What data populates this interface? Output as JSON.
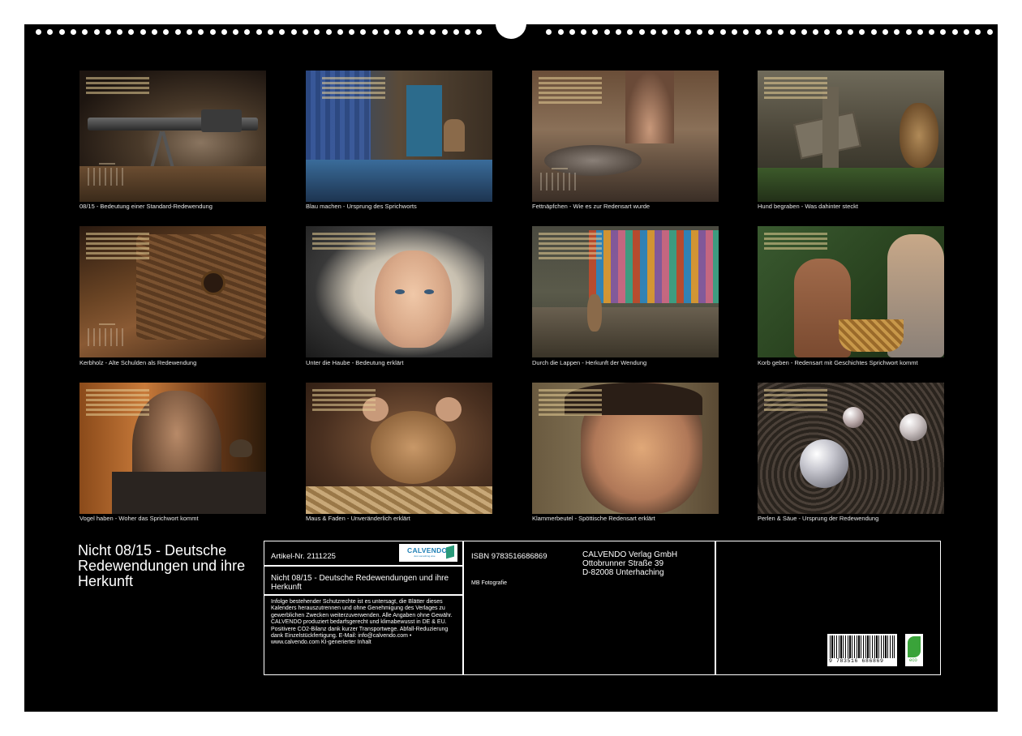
{
  "calendar_title": "Nicht 08/15 - Deutsche Redewendungen und ihre Herkunft",
  "months": [
    {
      "caption": "08/15 - Bedeutung einer Standard-Redewendung",
      "subject": "machine-gun-photo"
    },
    {
      "caption": "Blau machen - Ursprung des Sprichworts",
      "subject": "blue-dye-workshop-photo"
    },
    {
      "caption": "Fettnäpfchen - Wie es zur Redensart wurde",
      "subject": "grease-bowl-photo"
    },
    {
      "caption": "Hund begraben - Was dahinter steckt",
      "subject": "dog-grave-photo"
    },
    {
      "caption": "Kerbholz - Alte Schulden als Redewendung",
      "subject": "notched-wood-photo"
    },
    {
      "caption": "Unter die Haube - Bedeutung erklärt",
      "subject": "bonnet-woman-photo"
    },
    {
      "caption": "Durch die Lappen - Herkunft der Wendung",
      "subject": "hare-rags-photo"
    },
    {
      "caption": "Korb geben - Redensart mit Geschichtes Sprichwort kommt",
      "subject": "basket-couple-photo"
    },
    {
      "caption": "Vogel haben - Woher das Sprichwort kommt",
      "subject": "man-bird-photo"
    },
    {
      "caption": "Maus & Faden - Unveränderlich erklärt",
      "subject": "mouse-rope-photo"
    },
    {
      "caption": "Klammerbeutel - Spöttische Redensart erklärt",
      "subject": "woman-face-photo"
    },
    {
      "caption": "Perlen & Säue - Ursprung der Redewendung",
      "subject": "pearls-mud-photo"
    }
  ],
  "info": {
    "article_number": "Artikel-Nr. 2111225",
    "product_title": "Nicht 08/15 - Deutsche Redewendungen und ihre Herkunft",
    "legal_text": "Infolge bestehender Schutzrechte ist es untersagt, die Blätter dieses Kalenders herauszutrennen und ohne Genehmigung des Verlages zu gewerblichen Zwecken weiterzuverwenden. Alle Angaben ohne Gewähr. CALVENDO produziert bedarfsgerecht und klimabewusst in DE & EU. Positivere CO2-Bilanz dank kurzer Transportwege. Abfall-Reduzierung dank Einzelstückfertigung. E-Mail: info@calvendo.com • www.calvendo.com KI-generierter Inhalt",
    "isbn": "ISBN 9783516686869",
    "author": "MB Fotografie",
    "publisher_name": "CALVENDO Verlag GmbH",
    "publisher_street": "Ottobrunner Straße 39",
    "publisher_city": "D-82008 Unterhaching",
    "logo_text": "CALVENDO",
    "logo_subtext": "Just something else",
    "barcode_digits": "9 783516 686869",
    "eco_label": "eco"
  },
  "colors": {
    "background": "#000000",
    "text": "#ffffff",
    "logo_blue": "#1d7fb5",
    "eco_green": "#3aa33a"
  }
}
